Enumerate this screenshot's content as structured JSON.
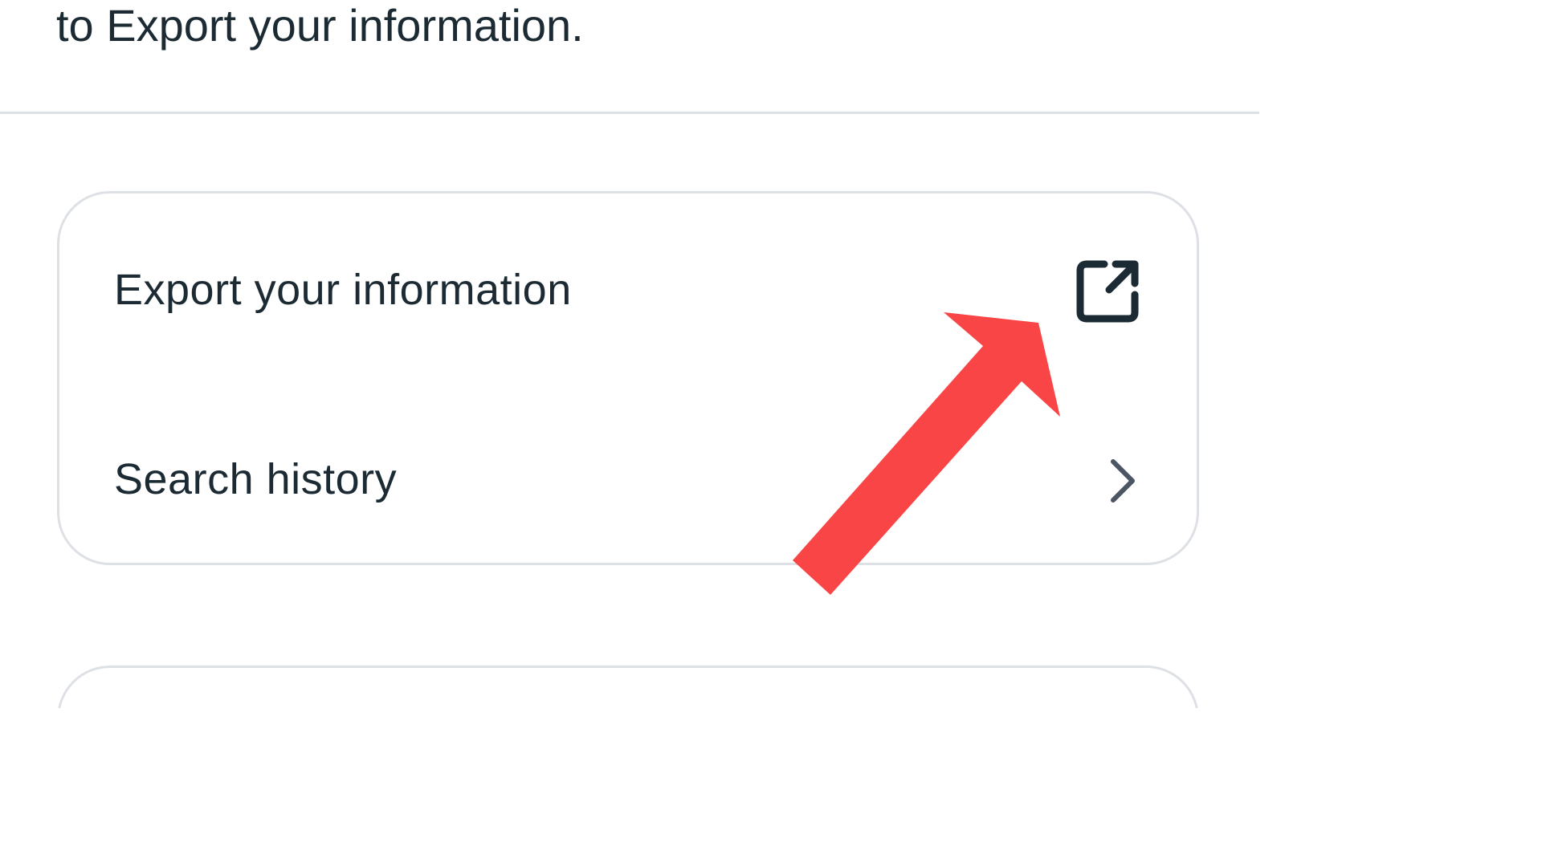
{
  "intro": {
    "text": "to Export your information."
  },
  "card": {
    "items": [
      {
        "label": "Export your information",
        "icon": "external-link-icon"
      },
      {
        "label": "Search history",
        "icon": "chevron-right-icon"
      }
    ]
  },
  "annotation": {
    "arrow_color": "#f94545"
  },
  "colors": {
    "text": "#1c2b33",
    "border": "#dde1e5",
    "icon": "#1c2b33"
  }
}
